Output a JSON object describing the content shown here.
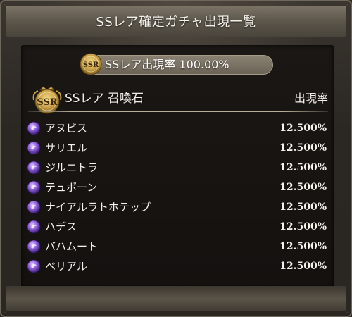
{
  "window": {
    "title": "SSレア確定ガチャ出現一覧"
  },
  "summary": {
    "badge": "SSR",
    "rate_label": "SSレア出現率 100.00%"
  },
  "table": {
    "badge": "SSR",
    "category_label": "SSレア 召喚石",
    "rate_header": "出現率",
    "rows": [
      {
        "name": "アヌビス",
        "rate": "12.500%"
      },
      {
        "name": "サリエル",
        "rate": "12.500%"
      },
      {
        "name": "ジルニトラ",
        "rate": "12.500%"
      },
      {
        "name": "テュポーン",
        "rate": "12.500%"
      },
      {
        "name": "ナイアルラトホテップ",
        "rate": "12.500%"
      },
      {
        "name": "ハデス",
        "rate": "12.500%"
      },
      {
        "name": "バハムート",
        "rate": "12.500%"
      },
      {
        "name": "ベリアル",
        "rate": "12.500%"
      }
    ]
  },
  "colors": {
    "accent_gold": "#c9a048",
    "orb_purple": "#7c4dd6",
    "text": "#f5f2ec"
  },
  "icons": {
    "badge": "ssr-crest-icon",
    "row": "dark-element-orb-icon"
  }
}
